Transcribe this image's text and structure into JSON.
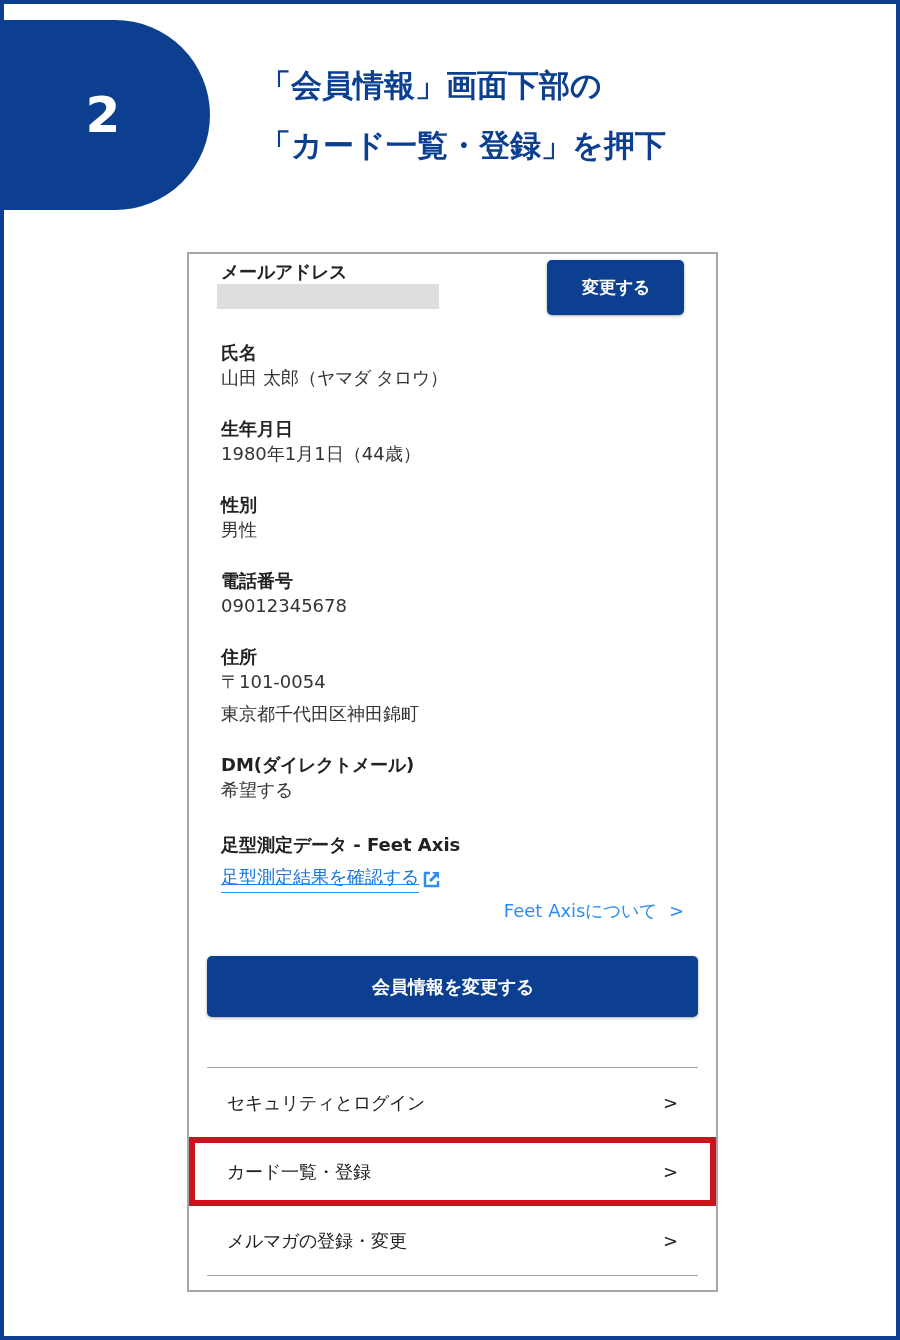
{
  "step": {
    "number": "2",
    "title_lines": [
      "「会員情報」画面下部の",
      "「カード一覧・登録」を押下"
    ]
  },
  "screen": {
    "email": {
      "label": "メールアドレス",
      "redacted": true,
      "button": "変更する"
    },
    "fields": [
      {
        "label": "氏名",
        "values": [
          "山田 太郎（ヤマダ タロウ）"
        ]
      },
      {
        "label": "生年月日",
        "values": [
          "1980年1月1日（44歳）"
        ]
      },
      {
        "label": "性別",
        "values": [
          "男性"
        ]
      },
      {
        "label": "電話番号",
        "values": [
          "09012345678"
        ]
      },
      {
        "label": "住所",
        "values": [
          "〒101-0054",
          "東京都千代田区神田錦町"
        ]
      },
      {
        "label": "DM(ダイレクトメール)",
        "values": [
          "希望する"
        ]
      }
    ],
    "feet": {
      "label": "足型測定データ - Feet Axis",
      "link": "足型測定結果を確認する",
      "about": "Feet Axisについて",
      "about_chevron": ">"
    },
    "submit": "会員情報を変更する",
    "menu": [
      {
        "label": "セキュリティとログイン",
        "chevron": ">",
        "highlighted": false
      },
      {
        "label": "カード一覧・登録",
        "chevron": ">",
        "highlighted": true
      },
      {
        "label": "メルマガの登録・変更",
        "chevron": ">",
        "highlighted": false
      }
    ]
  }
}
